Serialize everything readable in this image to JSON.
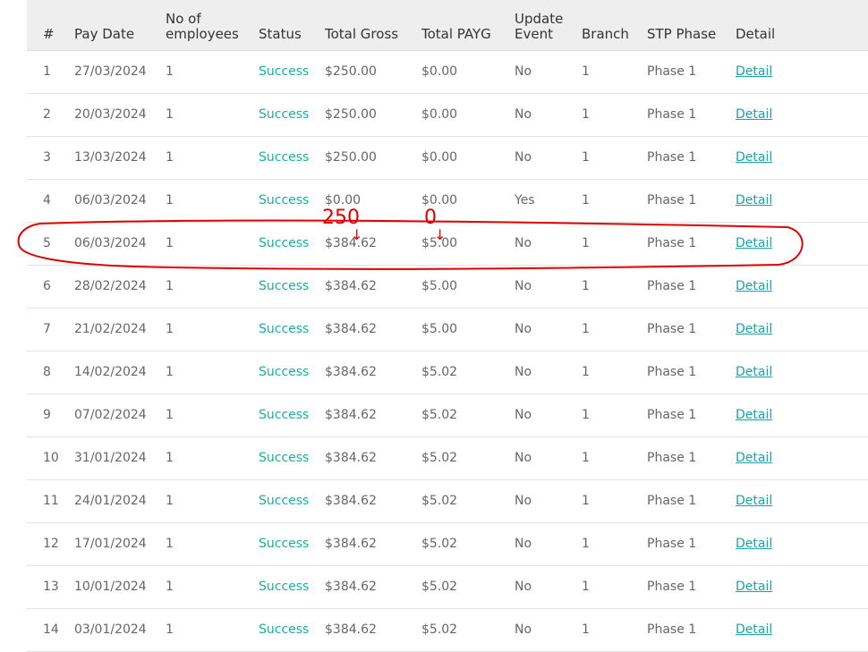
{
  "table": {
    "headers": {
      "num": "#",
      "pay_date": "Pay Date",
      "employees_line1": "No of",
      "employees_line2": "employees",
      "status": "Status",
      "total_gross": "Total Gross",
      "total_payg": "Total PAYG",
      "update_line1": "Update",
      "update_line2": "Event",
      "branch": "Branch",
      "stp_phase": "STP Phase",
      "detail": "Detail"
    },
    "rows": [
      {
        "num": "1",
        "date": "27/03/2024",
        "employees": "1",
        "status": "Success",
        "gross": "$250.00",
        "payg": "$0.00",
        "update": "No",
        "branch": "1",
        "phase": "Phase 1",
        "detail": "Detail"
      },
      {
        "num": "2",
        "date": "20/03/2024",
        "employees": "1",
        "status": "Success",
        "gross": "$250.00",
        "payg": "$0.00",
        "update": "No",
        "branch": "1",
        "phase": "Phase 1",
        "detail": "Detail"
      },
      {
        "num": "3",
        "date": "13/03/2024",
        "employees": "1",
        "status": "Success",
        "gross": "$250.00",
        "payg": "$0.00",
        "update": "No",
        "branch": "1",
        "phase": "Phase 1",
        "detail": "Detail"
      },
      {
        "num": "4",
        "date": "06/03/2024",
        "employees": "1",
        "status": "Success",
        "gross": "$0.00",
        "payg": "$0.00",
        "update": "Yes",
        "branch": "1",
        "phase": "Phase 1",
        "detail": "Detail"
      },
      {
        "num": "5",
        "date": "06/03/2024",
        "employees": "1",
        "status": "Success",
        "gross": "$384.62",
        "payg": "$5.00",
        "update": "No",
        "branch": "1",
        "phase": "Phase 1",
        "detail": "Detail"
      },
      {
        "num": "6",
        "date": "28/02/2024",
        "employees": "1",
        "status": "Success",
        "gross": "$384.62",
        "payg": "$5.00",
        "update": "No",
        "branch": "1",
        "phase": "Phase 1",
        "detail": "Detail"
      },
      {
        "num": "7",
        "date": "21/02/2024",
        "employees": "1",
        "status": "Success",
        "gross": "$384.62",
        "payg": "$5.00",
        "update": "No",
        "branch": "1",
        "phase": "Phase 1",
        "detail": "Detail"
      },
      {
        "num": "8",
        "date": "14/02/2024",
        "employees": "1",
        "status": "Success",
        "gross": "$384.62",
        "payg": "$5.02",
        "update": "No",
        "branch": "1",
        "phase": "Phase 1",
        "detail": "Detail"
      },
      {
        "num": "9",
        "date": "07/02/2024",
        "employees": "1",
        "status": "Success",
        "gross": "$384.62",
        "payg": "$5.02",
        "update": "No",
        "branch": "1",
        "phase": "Phase 1",
        "detail": "Detail"
      },
      {
        "num": "10",
        "date": "31/01/2024",
        "employees": "1",
        "status": "Success",
        "gross": "$384.62",
        "payg": "$5.02",
        "update": "No",
        "branch": "1",
        "phase": "Phase 1",
        "detail": "Detail"
      },
      {
        "num": "11",
        "date": "24/01/2024",
        "employees": "1",
        "status": "Success",
        "gross": "$384.62",
        "payg": "$5.02",
        "update": "No",
        "branch": "1",
        "phase": "Phase 1",
        "detail": "Detail"
      },
      {
        "num": "12",
        "date": "17/01/2024",
        "employees": "1",
        "status": "Success",
        "gross": "$384.62",
        "payg": "$5.02",
        "update": "No",
        "branch": "1",
        "phase": "Phase 1",
        "detail": "Detail"
      },
      {
        "num": "13",
        "date": "10/01/2024",
        "employees": "1",
        "status": "Success",
        "gross": "$384.62",
        "payg": "$5.02",
        "update": "No",
        "branch": "1",
        "phase": "Phase 1",
        "detail": "Detail"
      },
      {
        "num": "14",
        "date": "03/01/2024",
        "employees": "1",
        "status": "Success",
        "gross": "$384.62",
        "payg": "$5.02",
        "update": "No",
        "branch": "1",
        "phase": "Phase 1",
        "detail": "Detail"
      }
    ]
  },
  "annotation": {
    "gross_note": "250",
    "payg_note": "0",
    "arrow_glyph": "↓",
    "color": "#e00000"
  },
  "colors": {
    "status_success": "#1aaf9c",
    "detail_link": "#1aa3a8",
    "header_bg": "#eeeeee"
  }
}
